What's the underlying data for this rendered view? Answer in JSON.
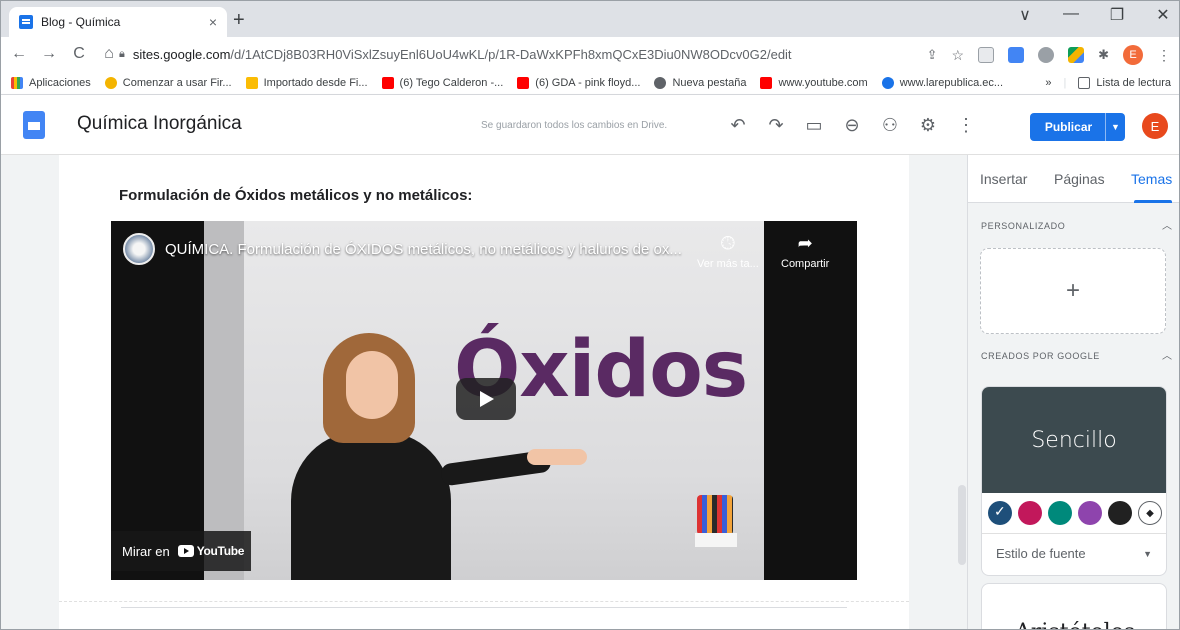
{
  "browser": {
    "tab_title": "Blog - Química",
    "tab_close": "×",
    "new_tab": "+",
    "url_host": "sites.google.com",
    "url_path": "/d/1AtCDj8B03RH0ViSxlZsuyEnl6UoU4wKL/p/1R-DaWxKPFh8xmQCxE3Diu0NW8ODcv0G2/edit",
    "window_controls": [
      "∨",
      "—",
      "❐",
      "✕"
    ],
    "nav": [
      "←",
      "→",
      "C",
      "⌂"
    ]
  },
  "bookmarks": {
    "items": [
      {
        "label": "Aplicaciones",
        "color": "#4285f4"
      },
      {
        "label": "Comenzar a usar Fir...",
        "color": "#f4b400"
      },
      {
        "label": "Importado desde Fi...",
        "color": "#fbbc04"
      },
      {
        "label": "(6) Tego Calderon -...",
        "color": "#ff0000"
      },
      {
        "label": "(6) GDA - pink floyd...",
        "color": "#ff0000"
      },
      {
        "label": "Nueva pestaña",
        "color": "#5f6368"
      },
      {
        "label": "www.youtube.com",
        "color": "#ff0000"
      },
      {
        "label": "www.larepublica.ec...",
        "color": "#1a73e8"
      }
    ],
    "more": "»",
    "reading_list": "Lista de lectura"
  },
  "sites": {
    "title": "Química Inorgánica",
    "save_status": "Se guardaron todos los cambios en Drive.",
    "publish_label": "Publicar",
    "avatar_letter": "E",
    "header_icons": [
      "undo-icon",
      "redo-icon",
      "preview-icon",
      "link-icon",
      "share-icon",
      "settings-icon",
      "more-icon"
    ]
  },
  "page": {
    "section_title": "Formulación de Óxidos metálicos y no metálicos:"
  },
  "video": {
    "title": "QUÍMICA. Formulación de ÓXIDOS metálicos, no metálicos y haluros de ox...",
    "watch_later": "Ver más ta...",
    "share": "Compartir",
    "board_text": "Óxidos",
    "watch_on": "Mirar en",
    "youtube": "YouTube"
  },
  "panel": {
    "tabs": [
      "Insertar",
      "Páginas",
      "Temas"
    ],
    "active_tab": "Temas",
    "section_custom": "PERSONALIZADO",
    "section_google": "CREADOS POR GOOGLE",
    "add_symbol": "+",
    "theme1": {
      "name": "Sencillo",
      "font_style": "Estilo de fuente",
      "swatches": [
        "#1e4f7a",
        "#c2185b",
        "#00897b",
        "#8e44ad",
        "#212121"
      ]
    },
    "theme2": {
      "name": "Aristóteles"
    }
  }
}
